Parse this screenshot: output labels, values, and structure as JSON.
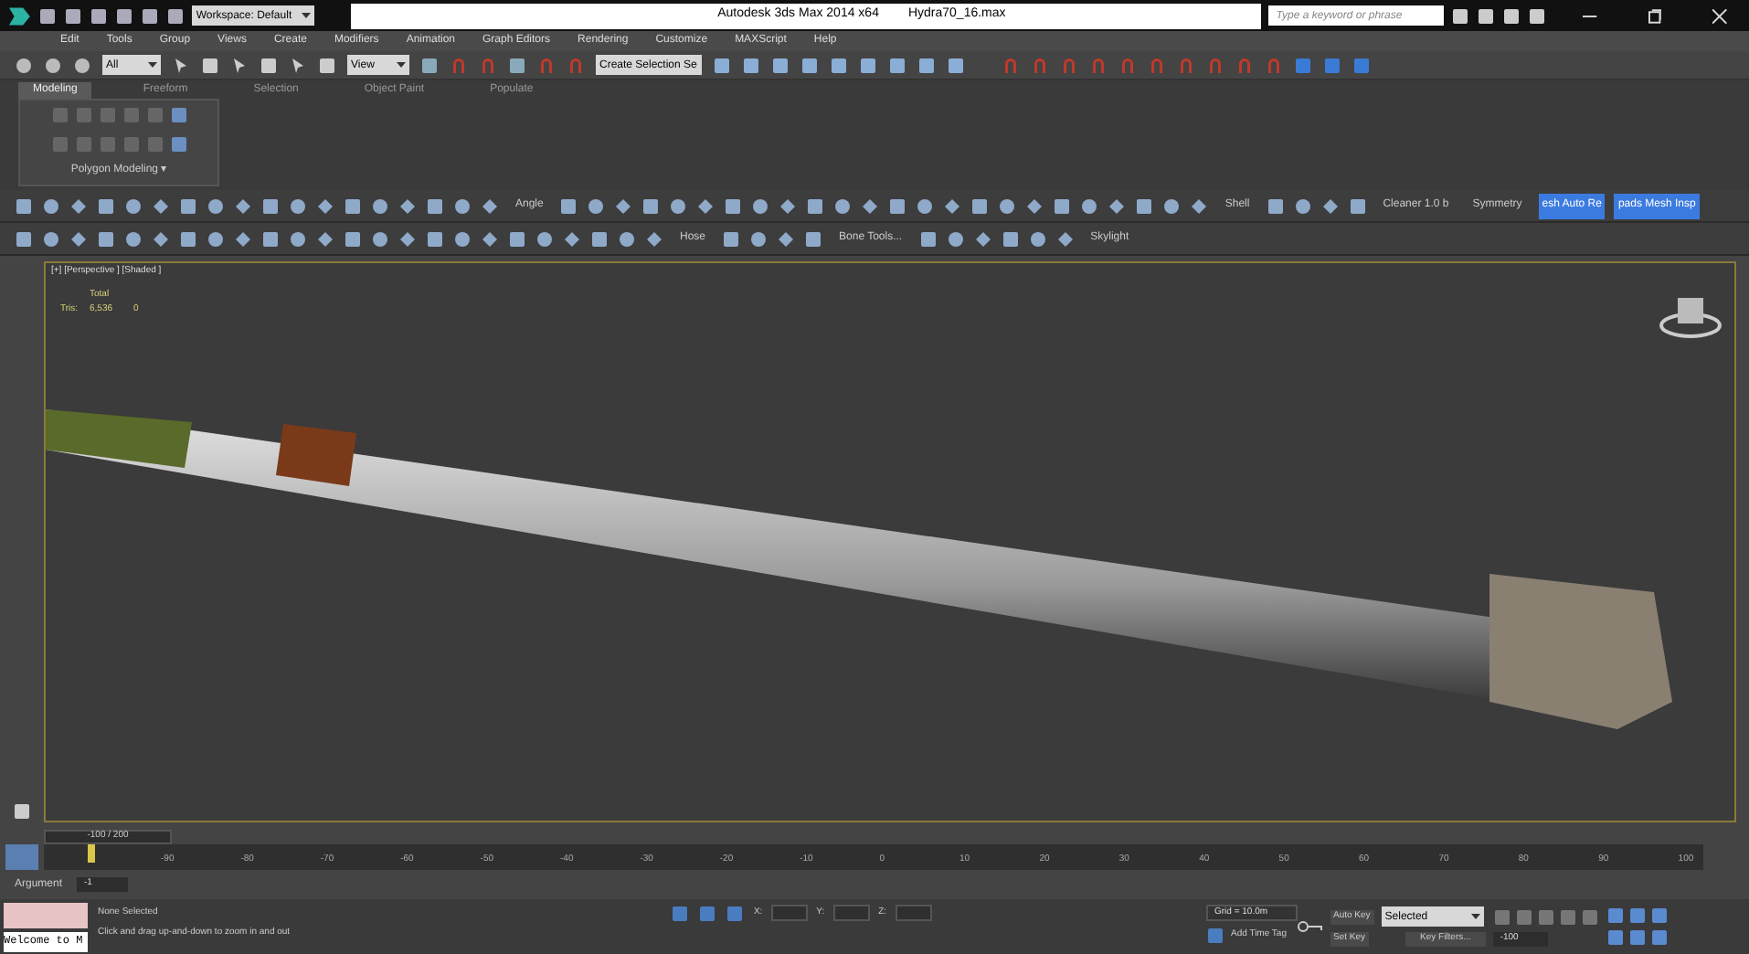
{
  "title_bar": {
    "workspace": "Workspace: Default",
    "title": "Autodesk 3ds Max  2014 x64",
    "file": "Hydra70_16.max",
    "search": {
      "placeholder": "Type a keyword or phrase"
    }
  },
  "menu": [
    "Edit",
    "Tools",
    "Group",
    "Views",
    "Create",
    "Modifiers",
    "Animation",
    "Graph Editors",
    "Rendering",
    "Customize",
    "MAXScript",
    "Help"
  ],
  "main_toolbar": {
    "selection_filter": "All",
    "reference_coord": "View",
    "named_selection": "Create Selection Se"
  },
  "ribbon": {
    "tabs": [
      {
        "label": "Modeling",
        "selected": true
      },
      {
        "label": "Freeform",
        "selected": false
      },
      {
        "label": "Selection",
        "selected": false
      },
      {
        "label": "Object Paint",
        "selected": false
      },
      {
        "label": "Populate",
        "selected": false
      }
    ],
    "panel_label": "Polygon Modeling ▾"
  },
  "toolbar_row_1": [
    {
      "kind": "label",
      "text": "Angle"
    },
    {
      "kind": "label",
      "text": "Shell"
    },
    {
      "kind": "label",
      "text": "Cleaner 1.0 b"
    },
    {
      "kind": "label",
      "text": "Symmetry"
    },
    {
      "kind": "button",
      "text": "esh Auto Re"
    },
    {
      "kind": "button",
      "text": "pads Mesh Insp"
    }
  ],
  "toolbar_row_2": [
    {
      "kind": "label",
      "text": "Hose"
    },
    {
      "kind": "label",
      "text": "Bone Tools..."
    },
    {
      "kind": "label",
      "text": "Skylight"
    }
  ],
  "viewport": {
    "label": "[+] [Perspective ] [Shaded ]",
    "stats": {
      "heading": "Total",
      "label": "Tris:",
      "total": "6,536",
      "selected": "0"
    }
  },
  "frame_counter": "-100 / 200",
  "track_ticks": [
    "-90",
    "-80",
    "-70",
    "-60",
    "-50",
    "-40",
    "-30",
    "-20",
    "-10",
    "0",
    "10",
    "20",
    "30",
    "40",
    "50",
    "60",
    "70",
    "80",
    "90",
    "100"
  ],
  "argument": {
    "label": "Argument",
    "value": "-1"
  },
  "status": {
    "prompt_box": "Welcome to M",
    "selection": "None Selected",
    "prompt": "Click and drag up-and-down to zoom in and out",
    "coords": [
      "X:",
      "Y:",
      "Z:"
    ],
    "grid": "Grid = 10.0m",
    "add_time_tag": "Add Time Tag",
    "auto_key": "Auto Key",
    "key_mode": "Selected",
    "set_key": "Set Key",
    "key_filters": "Key Filters...",
    "current_frame": "-100"
  }
}
